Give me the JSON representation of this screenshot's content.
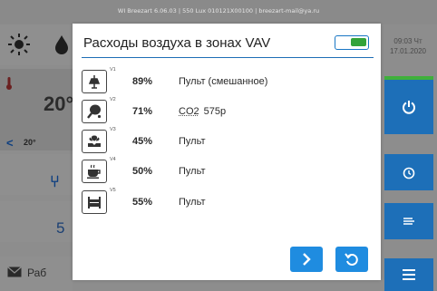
{
  "topbar": {
    "text": "WI Breezart 6.06.03 | 550 Lux 010121X00100 | breezart-mail@ya.ru"
  },
  "background": {
    "temperature": "20°",
    "setpoint": "20°",
    "setpoint_arrow": "<",
    "counter": "5",
    "mode_label": "Раб",
    "date_line1": "09:03 Чт",
    "date_line2": "17.01.2020"
  },
  "modal": {
    "title": "Расходы воздуха в зонах VAV",
    "enabled": true,
    "zones": [
      {
        "tag": "V1",
        "icon": "ceiling-lamp-icon",
        "percent": "89%",
        "mode": "Пульт (смешанное)",
        "value": ""
      },
      {
        "tag": "V2",
        "icon": "table-tennis-icon",
        "percent": "71%",
        "mode": "CO2",
        "value": "575p"
      },
      {
        "tag": "V3",
        "icon": "plant-hand-icon",
        "percent": "45%",
        "mode": "Пульт",
        "value": ""
      },
      {
        "tag": "V4",
        "icon": "coffee-cup-icon",
        "percent": "50%",
        "mode": "Пульт",
        "value": ""
      },
      {
        "tag": "V5",
        "icon": "bed-icon",
        "percent": "55%",
        "mode": "Пульт",
        "value": ""
      }
    ],
    "next_icon": "chevron-right-icon",
    "back_icon": "undo-icon"
  },
  "colors": {
    "accent": "#1f8ce0",
    "divider": "#1e6eb6",
    "toggle_on": "#33a33a",
    "tile_blue": "#1d6fb8"
  }
}
